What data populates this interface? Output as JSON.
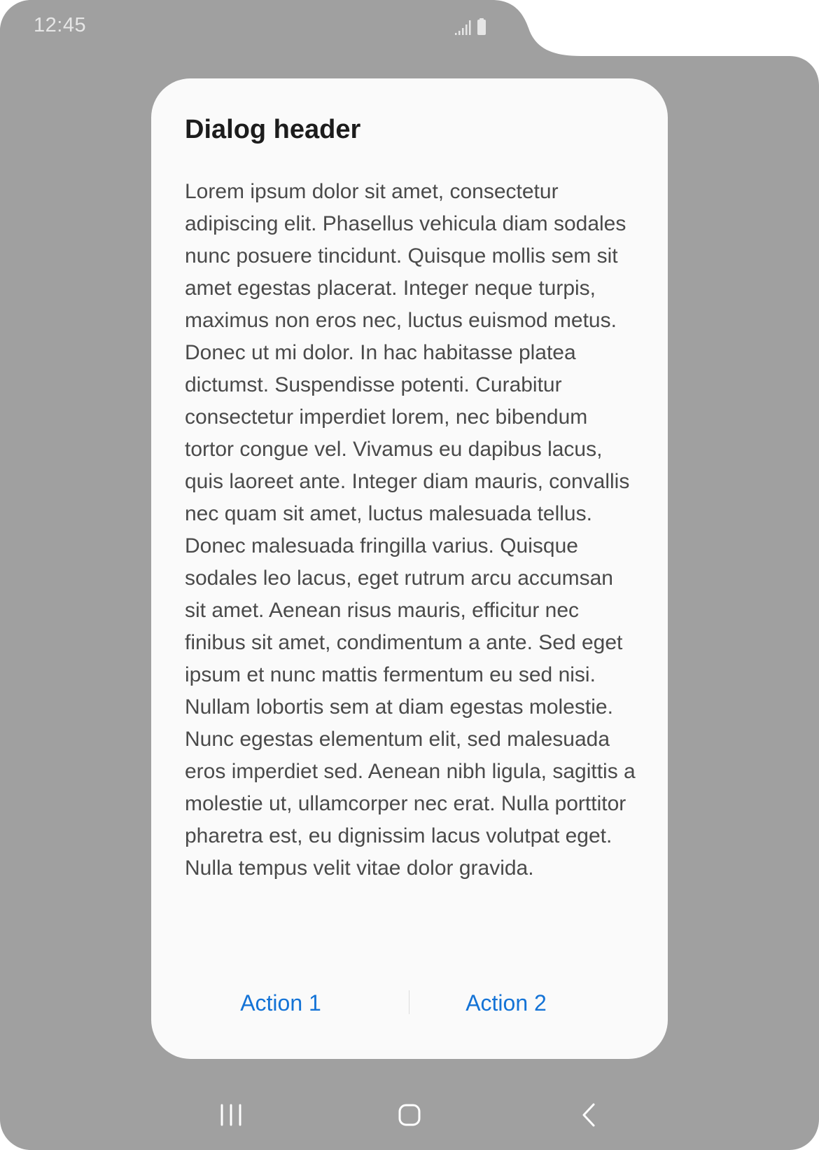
{
  "status_bar": {
    "time": "12:45",
    "icons": [
      "cellular-signal-icon",
      "battery-icon"
    ]
  },
  "dialog": {
    "title": "Dialog header",
    "body": "Lorem ipsum dolor sit amet, consectetur adipiscing elit. Phasellus vehicula diam sodales nunc posuere tincidunt. Quisque mollis sem sit amet egestas placerat. Integer neque turpis, maximus non eros nec, luctus euismod metus. Donec ut mi dolor. In hac habitasse platea dictumst. Suspendisse potenti. Curabitur consectetur imperdiet lorem, nec bibendum tortor congue vel. Vivamus eu dapibus lacus, quis laoreet ante. Integer diam mauris, convallis nec quam sit amet, luctus malesuada tellus. Donec malesuada fringilla varius. Quisque sodales leo lacus, eget rutrum arcu accumsan sit amet. Aenean risus mauris, efficitur nec finibus sit amet, condimentum a ante. Sed eget ipsum et nunc mattis fermentum eu sed nisi. Nullam lobortis sem at diam egestas molestie. Nunc egestas elementum elit, sed malesuada eros imperdiet sed. Aenean nibh ligula, sagittis a molestie ut, ullamcorper nec erat. Nulla porttitor pharetra est, eu dignissim lacus volutpat eget. Nulla tempus velit vitae dolor gravida.",
    "actions": [
      {
        "label": "Action 1"
      },
      {
        "label": "Action 2"
      }
    ]
  },
  "nav_bar": {
    "icons": [
      "recent-apps-icon",
      "home-icon",
      "back-icon"
    ]
  },
  "colors": {
    "scrim": "#a0a0a0",
    "dialog_background": "#fafafa",
    "title_text": "#1c1c1c",
    "body_text": "#4a4a4a",
    "action_text": "#1473d6",
    "status_text": "#e6e6e6"
  }
}
